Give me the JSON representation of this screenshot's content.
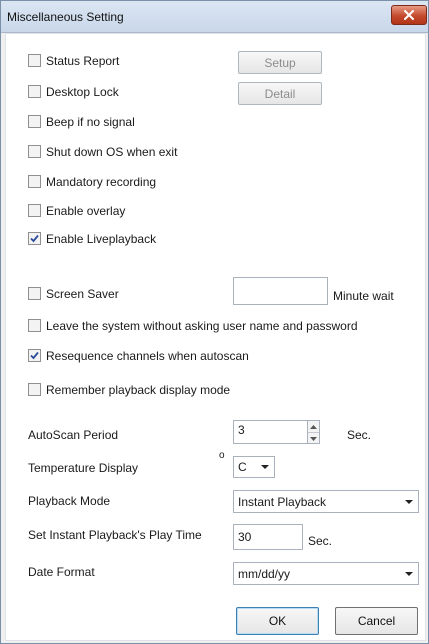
{
  "window": {
    "title": "Miscellaneous Setting"
  },
  "checkboxes": {
    "status_report": {
      "label": "Status Report",
      "checked": false
    },
    "desktop_lock": {
      "label": "Desktop Lock",
      "checked": false
    },
    "beep_no_signal": {
      "label": "Beep if no signal",
      "checked": false
    },
    "shutdown_os": {
      "label": "Shut down OS when exit",
      "checked": false
    },
    "mandatory_recording": {
      "label": "Mandatory recording",
      "checked": false
    },
    "enable_overlay": {
      "label": "Enable overlay",
      "checked": false
    },
    "enable_liveplayback": {
      "label": "Enable Liveplayback",
      "checked": true
    },
    "screen_saver": {
      "label": "Screen Saver",
      "checked": false
    },
    "leave_system": {
      "label": "Leave the system without asking user name and password",
      "checked": false
    },
    "resequence": {
      "label": "Resequence channels when autoscan",
      "checked": true
    },
    "remember_playback": {
      "label": "Remember playback display mode",
      "checked": false
    }
  },
  "buttons": {
    "setup": "Setup",
    "detail": "Detail",
    "ok": "OK",
    "cancel": "Cancel"
  },
  "screen_saver": {
    "value": "",
    "unit": "Minute wait"
  },
  "autoscan": {
    "label": "AutoScan Period",
    "value": "3",
    "unit": "Sec."
  },
  "temperature": {
    "label": "Temperature Display",
    "degree": "o",
    "value": "C"
  },
  "playback_mode": {
    "label": "Playback Mode",
    "value": "Instant Playback"
  },
  "instant_play_time": {
    "label": "Set Instant Playback's Play Time",
    "value": "30",
    "unit": "Sec."
  },
  "date_format": {
    "label": "Date Format",
    "value": "mm/dd/yy"
  },
  "colors": {
    "title_bar": "#c8d7ea",
    "close_button": "#c44a2d",
    "default_button_border": "#3c7fb1",
    "check_mark": "#2b4c9c"
  },
  "icons": {
    "close": "close-x-icon",
    "check": "check-mark-icon",
    "dropdown": "chevron-down-icon",
    "spin_up": "spin-up-icon",
    "spin_down": "spin-down-icon"
  }
}
